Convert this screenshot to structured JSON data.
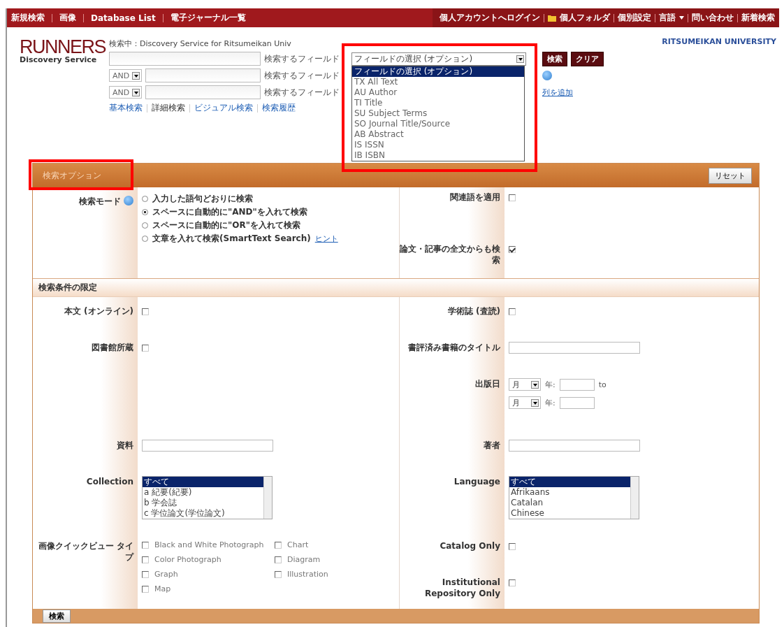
{
  "top_nav": {
    "left": [
      "新規検索",
      "画像",
      "Database List",
      "電子ジャーナル一覧"
    ],
    "right": [
      {
        "kind": "link",
        "label": "個人アカウントへログイン"
      },
      {
        "kind": "folder",
        "label": "個人フォルダ"
      },
      {
        "kind": "link",
        "label": "個別設定"
      },
      {
        "kind": "menu",
        "label": "言語"
      },
      {
        "kind": "link",
        "label": "問い合わせ"
      },
      {
        "kind": "link",
        "label": "新着検索"
      }
    ]
  },
  "header": {
    "logo": {
      "title": "RUNNERS",
      "subtitle": "Discovery Service"
    },
    "searching": "検索中：Discovery Service for Ritsumeikan Univ",
    "university": "RITSUMEIKAN UNIVERSITY"
  },
  "search_rows": [
    {
      "field_label": "検索するフィールド",
      "field_select": "フィールドの選択 (オプション)"
    },
    {
      "operator": "AND",
      "field_label": "検索するフィールド"
    },
    {
      "operator": "AND",
      "field_label": "検索するフィールド"
    }
  ],
  "buttons": [
    "検索",
    "クリア"
  ],
  "add_row_link": "列を追加",
  "search_modes": [
    {
      "label": "基本検索",
      "selected": false
    },
    {
      "label": "詳細検索",
      "selected": true
    },
    {
      "label": "ビジュアル検索",
      "selected": false
    },
    {
      "label": "検索履歴",
      "selected": false
    }
  ],
  "field_dropdown": {
    "highlighted": true,
    "options": [
      {
        "label": "フィールドの選択 (オプション)",
        "selected": true
      },
      {
        "label": "TX All Text",
        "selected": false
      },
      {
        "label": "AU Author",
        "selected": false
      },
      {
        "label": "TI Title",
        "selected": false
      },
      {
        "label": "SU Subject Terms",
        "selected": false
      },
      {
        "label": "SO Journal Title/Source",
        "selected": false
      },
      {
        "label": "AB Abstract",
        "selected": false
      },
      {
        "label": "IS ISSN",
        "selected": false
      },
      {
        "label": "IB ISBN",
        "selected": false
      }
    ]
  },
  "options_panel": {
    "title": "検索オプション",
    "highlighted": true,
    "reset": "リセット",
    "mode": {
      "label": "検索モード",
      "choices": [
        {
          "label": "入力した語句どおりに検索",
          "selected": false
        },
        {
          "label": "スペースに自動的に\"AND\"を入れて検索",
          "selected": true
        },
        {
          "label": "スペースに自動的に\"OR\"を入れて検索",
          "selected": false
        },
        {
          "label": "文章を入れて検索(SmartText Search)",
          "selected": false,
          "link": "ヒント"
        }
      ]
    },
    "mode_right": [
      {
        "label": "関連語を適用",
        "checked": false
      },
      {
        "label": "論文・記事の全文からも検索",
        "checked": true
      }
    ],
    "limit_title": "検索条件の限定",
    "rows": [
      {
        "left": {
          "kind": "checkbox",
          "label": "本文 (オンライン)",
          "checked": false
        },
        "right": {
          "kind": "checkbox",
          "label": "学術誌 (査読)",
          "checked": false
        }
      },
      {
        "left": {
          "kind": "checkbox",
          "label": "図書館所蔵",
          "checked": false
        },
        "right": {
          "kind": "text",
          "label": "書評済み書籍のタイトル"
        }
      },
      {
        "right": {
          "kind": "date",
          "label": "出版日",
          "lines": [
            {
              "month": "月",
              "year_label": "年:",
              "to": "to"
            },
            {
              "month": "月",
              "year_label": "年:"
            }
          ]
        }
      },
      {
        "left": {
          "kind": "text",
          "label": "資料"
        },
        "right": {
          "kind": "text",
          "label": "著者"
        }
      },
      {
        "left": {
          "kind": "listbox",
          "label": "Collection",
          "options": [
            {
              "label": "すべて",
              "selected": true
            },
            {
              "label": "a 紀要(紀要)",
              "selected": false
            },
            {
              "label": "b 学会誌",
              "selected": false
            },
            {
              "label": "c 学位論文(学位論文)",
              "selected": false
            }
          ]
        },
        "right": {
          "kind": "listbox",
          "label": "Language",
          "options": [
            {
              "label": "すべて",
              "selected": true
            },
            {
              "label": "Afrikaans",
              "selected": false
            },
            {
              "label": "Catalan",
              "selected": false
            },
            {
              "label": "Chinese",
              "selected": false
            }
          ]
        }
      },
      {
        "left": {
          "kind": "checkgroup",
          "label": "画像クイックビュー タイプ",
          "options": [
            {
              "label": "Black and White Photograph",
              "checked": false
            },
            {
              "label": "Chart",
              "checked": false
            },
            {
              "label": "Color Photograph",
              "checked": false
            },
            {
              "label": "Diagram",
              "checked": false
            },
            {
              "label": "Graph",
              "checked": false
            },
            {
              "label": "Illustration",
              "checked": false
            },
            {
              "label": "Map",
              "checked": false
            }
          ]
        },
        "right": {
          "kind": "checkbox",
          "label": "Catalog Only",
          "checked": false
        }
      },
      {
        "right": {
          "kind": "checkbox",
          "label": "Institutional Repository Only",
          "checked": false
        }
      }
    ],
    "submit": "検索"
  }
}
